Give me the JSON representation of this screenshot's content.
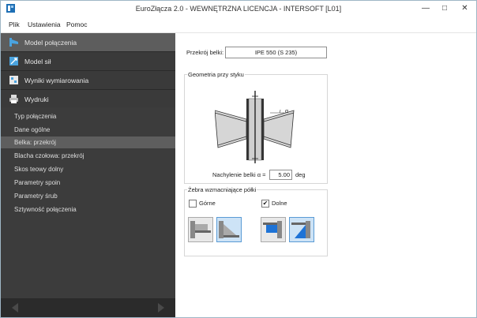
{
  "window": {
    "title": "EuroZłącza 2.0 - WEWNĘTRZNA LICENCJA - INTERSOFT [L01]"
  },
  "menu": [
    "Plik",
    "Ustawienia",
    "Pomoc"
  ],
  "nav": [
    {
      "label": "Model połączenia",
      "icon": "connection-model-icon",
      "active": true
    },
    {
      "label": "Model sił",
      "icon": "forces-model-icon",
      "active": false
    },
    {
      "label": "Wyniki wymiarowania",
      "icon": "results-icon",
      "active": false
    },
    {
      "label": "Wydruki",
      "icon": "printer-icon",
      "active": false
    }
  ],
  "subnav": [
    "Typ połączenia",
    "Dane ogólne",
    "Belka: przekrój",
    "Blacha czołowa: przekrój",
    "Skos teowy dolny",
    "Parametry spoin",
    "Parametry śrub",
    "Sztywność połączenia"
  ],
  "subnav_active": "Belka: przekrój",
  "content": {
    "section_label": "Przekrój belki:",
    "section_value": "IPE 550 (S 235)",
    "geometry": {
      "title": "Geometria przy styku",
      "angle_label": "Nachylenie belki α =",
      "angle_value": "5.00",
      "angle_unit": "deg",
      "alpha_symbol": "α"
    },
    "ribs": {
      "title": "Żebra wzmacniające półki",
      "top_label": "Górne",
      "top_checked": false,
      "bottom_label": "Dolne",
      "bottom_checked": true,
      "check_mark": "✔"
    }
  }
}
